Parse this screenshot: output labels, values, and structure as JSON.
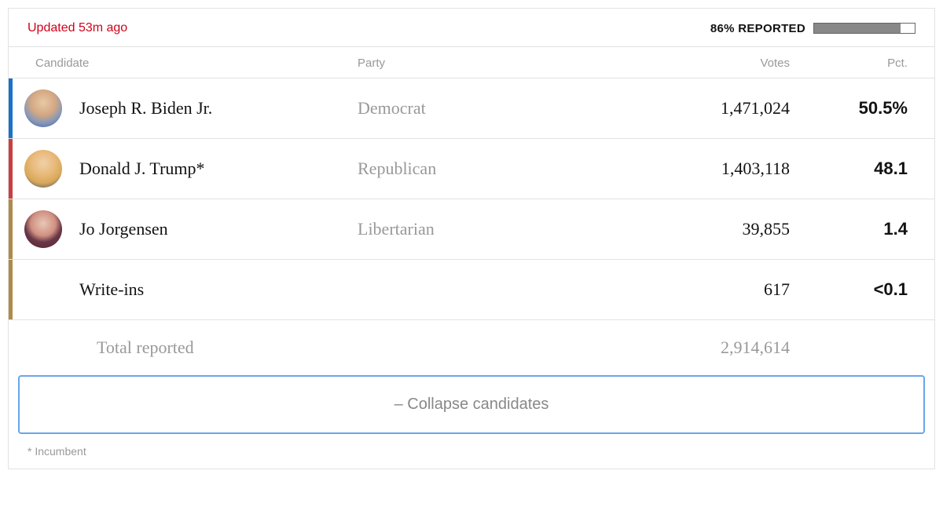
{
  "header": {
    "updated_text": "Updated 53m ago",
    "reported_label": "86% REPORTED",
    "reported_pct": 86
  },
  "columns": {
    "candidate": "Candidate",
    "party": "Party",
    "votes": "Votes",
    "pct": "Pct."
  },
  "candidates": [
    {
      "name": "Joseph R. Biden Jr.",
      "party": "Democrat",
      "votes": "1,471,024",
      "pct": "50.5%",
      "color": "#1a73c8",
      "avatar_class": "biden"
    },
    {
      "name": "Donald J. Trump*",
      "party": "Republican",
      "votes": "1,403,118",
      "pct": "48.1",
      "color": "#c93f3f",
      "avatar_class": "trump"
    },
    {
      "name": "Jo Jorgensen",
      "party": "Libertarian",
      "votes": "39,855",
      "pct": "1.4",
      "color": "#b08a4a",
      "avatar_class": "jorgensen"
    },
    {
      "name": "Write-ins",
      "party": "",
      "votes": "617",
      "pct": "<0.1",
      "color": "#b08a4a",
      "avatar_class": "none"
    }
  ],
  "total": {
    "label": "Total reported",
    "votes": "2,914,614"
  },
  "collapse_label": "– Collapse candidates",
  "footnote": "* Incumbent"
}
